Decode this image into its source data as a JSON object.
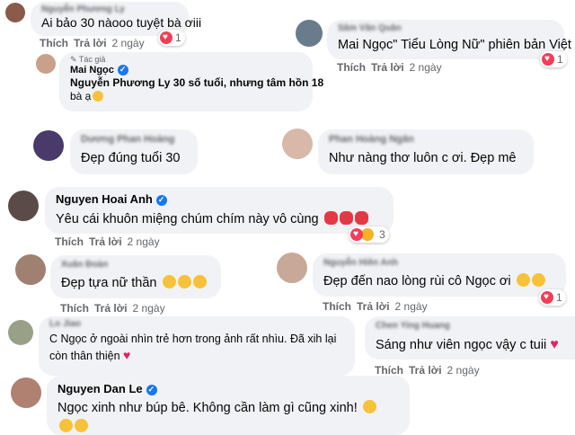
{
  "actions": {
    "like": "Thích",
    "reply": "Trả lời",
    "time": "2 ngày"
  },
  "comments": [
    {
      "name": "Nguyễn Phương Ly",
      "text": "Ai bảo 30 nàooo tuyệt bà ơiii",
      "reaction_count": "1"
    },
    {
      "name": "Sâm Văn Quân",
      "text": "Mai Ngọc\" Tiểu Lòng Nữ\" phiên bản Việt",
      "reaction_count": "1"
    },
    {
      "author_tag": "Tác giả",
      "name": "Mai Ngọc",
      "text_line1": "Nguyễn Phương Ly 30 số tuổi, nhưng tâm hồn 18",
      "text_line2": "bà ạ"
    },
    {
      "name": "Dương Phan Hoàng",
      "text": "Đẹp đúng tuổi 30"
    },
    {
      "name": "Phan Hoàng Ngân",
      "text": "Như nàng thơ luôn c ơi. Đẹp mê"
    },
    {
      "name": "Nguyen Hoai Anh",
      "text": "Yêu cái khuôn miệng chúm chím này vô cùng",
      "reaction_count": "3"
    },
    {
      "name": "Xuân Đoàn",
      "text": "Đẹp tựa nữ thần"
    },
    {
      "name": "Nguyễn Hiền Anh",
      "text": "Đẹp đến nao lòng rùi cô Ngọc ơi",
      "reaction_count": "1"
    },
    {
      "name": "Lo Jiao",
      "text_line1": "C Ngọc ở ngoài nhìn trẻ hơn trong ảnh rất nhìu. Đã xih lại",
      "text_line2": "còn thân thiện"
    },
    {
      "name": "Chen Ying Huang",
      "text": "Sáng như viên ngọc vậy c tuii"
    },
    {
      "name": "Nguyen Dan Le",
      "text": "Ngọc xinh như búp bê. Không cần làm gì cũng xinh!"
    }
  ],
  "icons": [
    "heart-reaction-icon",
    "haha-reaction-icon",
    "verified-badge-icon",
    "lips-emoji-icon",
    "blush-emoji-icon",
    "red-heart-emoji-icon"
  ],
  "colors": {
    "bubble": "#f0f2f5",
    "verified": "#1877f2",
    "love": "#f33e58",
    "meta_text": "#65676b"
  }
}
